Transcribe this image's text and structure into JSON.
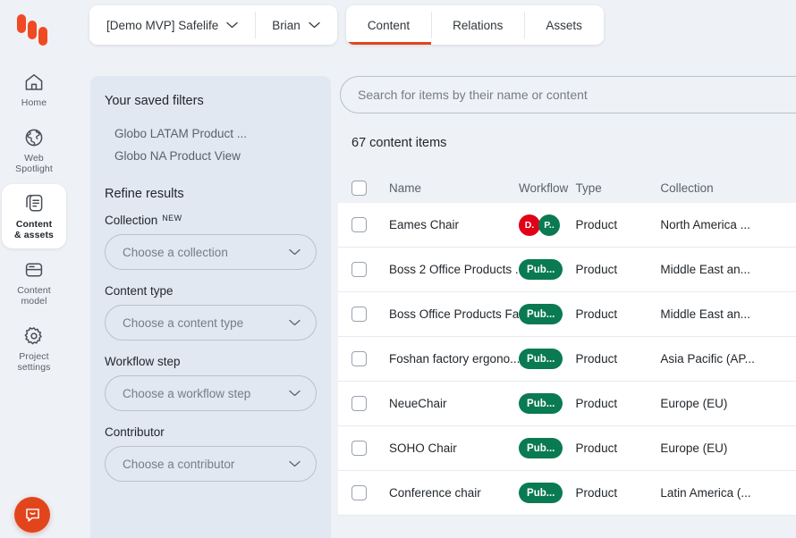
{
  "app": {
    "logo_name": "kontent-ai-logo"
  },
  "sidebar": {
    "items": [
      {
        "label": "Home",
        "icon": "home-icon",
        "active": false
      },
      {
        "label": "Web\nSpotlight",
        "icon": "globe-icon",
        "active": false
      },
      {
        "label": "Content\n& assets",
        "icon": "content-stack-icon",
        "active": true
      },
      {
        "label": "Content\nmodel",
        "icon": "content-model-icon",
        "active": false
      },
      {
        "label": "Project\nsettings",
        "icon": "gear-icon",
        "active": false
      }
    ],
    "chat": {
      "icon": "chat-smile-icon",
      "color": "#e2451b"
    }
  },
  "topbar": {
    "project": "[Demo MVP] Safelife",
    "environment": "Brian",
    "tabs": [
      {
        "label": "Content",
        "active": true
      },
      {
        "label": "Relations",
        "active": false
      },
      {
        "label": "Assets",
        "active": false
      }
    ],
    "accent_color": "#e2451b"
  },
  "filters": {
    "saved_title": "Your saved filters",
    "saved": [
      "Globo LATAM Product ...",
      "Globo NA Product View"
    ],
    "refine_title": "Refine results",
    "groups": [
      {
        "label": "Collection",
        "badge": "NEW",
        "placeholder": "Choose a collection"
      },
      {
        "label": "Content type",
        "badge": "",
        "placeholder": "Choose a content type"
      },
      {
        "label": "Workflow step",
        "badge": "",
        "placeholder": "Choose a workflow step"
      },
      {
        "label": "Contributor",
        "badge": "",
        "placeholder": "Choose a contributor"
      }
    ]
  },
  "search": {
    "value": "",
    "placeholder": "Search for items by their name or content"
  },
  "results": {
    "count_label": "67 content items",
    "columns": {
      "name": "Name",
      "workflow": "Workflow",
      "type": "Type",
      "collection": "Collection"
    },
    "rows": [
      {
        "name": "Eames Chair",
        "workflow_kind": "dots",
        "workflow_dots": [
          {
            "text": "D.",
            "color": "#e00018"
          },
          {
            "text": "P..",
            "color": "#0a7a52"
          }
        ],
        "workflow": "",
        "type": "Product",
        "collection": "North America ..."
      },
      {
        "name": "Boss 2 Office Products ...",
        "workflow_kind": "badge",
        "workflow": "Pub...",
        "workflow_color": "#0a7a52",
        "type": "Product",
        "collection": "Middle East an..."
      },
      {
        "name": "Boss Office Products Fa...",
        "workflow_kind": "badge",
        "workflow": "Pub...",
        "workflow_color": "#0a7a52",
        "type": "Product",
        "collection": "Middle East an..."
      },
      {
        "name": "Foshan factory ergono...",
        "workflow_kind": "badge",
        "workflow": "Pub...",
        "workflow_color": "#0a7a52",
        "type": "Product",
        "collection": "Asia Pacific (AP..."
      },
      {
        "name": "NeueChair",
        "workflow_kind": "badge",
        "workflow": "Pub...",
        "workflow_color": "#0a7a52",
        "type": "Product",
        "collection": "Europe (EU)"
      },
      {
        "name": "SOHO Chair",
        "workflow_kind": "badge",
        "workflow": "Pub...",
        "workflow_color": "#0a7a52",
        "type": "Product",
        "collection": "Europe (EU)"
      },
      {
        "name": "Conference chair",
        "workflow_kind": "badge",
        "workflow": "Pub...",
        "workflow_color": "#0a7a52",
        "type": "Product",
        "collection": "Latin America (..."
      }
    ]
  }
}
